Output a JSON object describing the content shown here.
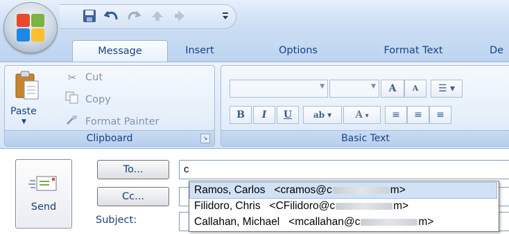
{
  "qat": {
    "save_icon": "save-icon",
    "undo_icon": "undo-icon",
    "redo_icon": "redo-icon",
    "previous_icon": "previous-item-icon",
    "next_icon": "next-item-icon",
    "customize_icon": "customize-qat-icon"
  },
  "tabs": [
    {
      "label": "Message",
      "active": true
    },
    {
      "label": "Insert"
    },
    {
      "label": "Options"
    },
    {
      "label": "Format Text"
    },
    {
      "label": "De"
    }
  ],
  "ribbon": {
    "clipboard": {
      "paste_label": "Paste",
      "cut_label": "Cut",
      "copy_label": "Copy",
      "format_painter_label": "Format Painter",
      "group_label": "Clipboard"
    },
    "basic_text": {
      "group_label": "Basic Text",
      "bold": "B",
      "italic": "I",
      "underline": "U",
      "grow_font": "A",
      "shrink_font": "A",
      "highlight": "ab",
      "font_color": "A"
    }
  },
  "message": {
    "send_label": "Send",
    "to_button": "To...",
    "cc_button": "Cc...",
    "subject_label": "Subject:",
    "to_value": "c"
  },
  "autocomplete": [
    {
      "name": "Ramos, Carlos",
      "email_start": "<cramos@c",
      "email_end": "m>",
      "selected": true
    },
    {
      "name": "Filidoro, Chris",
      "email_start": "<CFilidoro@c",
      "email_end": "m>"
    },
    {
      "name": "Callahan, Michael",
      "email_start": "<mcallahan@c",
      "email_end": "m>"
    }
  ],
  "colors": {
    "accent": "#15428b",
    "ribbon_bg": "#dfeaf8",
    "selection": "#d2e2f6"
  }
}
